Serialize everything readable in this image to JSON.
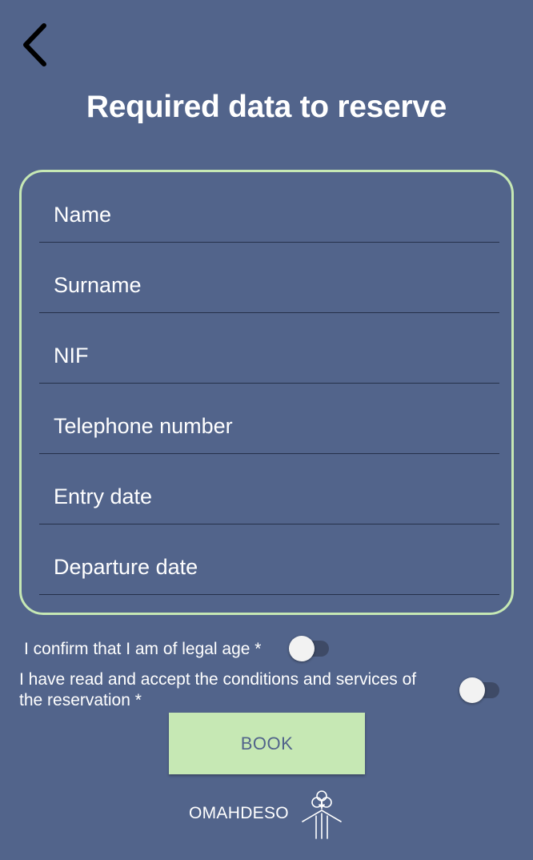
{
  "header": {
    "back_icon": "chevron-left-icon",
    "title": "Required data to reserve"
  },
  "form": {
    "fields": [
      {
        "placeholder": "Name",
        "value": ""
      },
      {
        "placeholder": "Surname",
        "value": ""
      },
      {
        "placeholder": "NIF",
        "value": ""
      },
      {
        "placeholder": "Telephone number",
        "value": ""
      },
      {
        "placeholder": "Entry date",
        "value": ""
      },
      {
        "placeholder": "Departure date",
        "value": ""
      }
    ]
  },
  "consents": {
    "legal_age": {
      "label": "I confirm that I am of legal age *",
      "checked": false
    },
    "conditions": {
      "label_line1": "I have read and accept the conditions and services of",
      "label_line2": "the reservation *",
      "checked": false
    }
  },
  "book_button": {
    "label": "BOOK"
  },
  "footer": {
    "brand_name": "OMAHDESO",
    "logo_icon": "tree-house-icon"
  },
  "colors": {
    "background": "#52648b",
    "accent": "#c6e8b4",
    "text": "#ffffff"
  }
}
